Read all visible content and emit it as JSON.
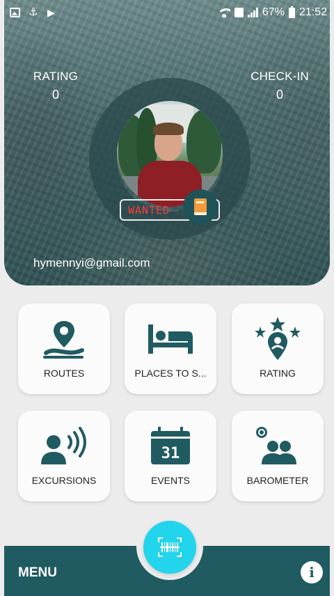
{
  "status_bar": {
    "battery": "67%",
    "time": "21:52",
    "left_icons": [
      "gallery-icon",
      "anchor-icon",
      "flag-icon"
    ],
    "right_icons": [
      "wifi-icon",
      "sim-icon",
      "signal-icon",
      "battery-icon"
    ]
  },
  "profile": {
    "rating_label": "RATING",
    "rating_value": "0",
    "checkin_label": "CHECK-IN",
    "checkin_value": "0",
    "badge_text": "WANTED",
    "email": "hymennyi@gmail.com"
  },
  "tiles": [
    {
      "label": "ROUTES",
      "icon": "route-pin-icon"
    },
    {
      "label": "PLACES TO S...",
      "icon": "bed-icon"
    },
    {
      "label": "RATING",
      "icon": "stars-pin-icon"
    },
    {
      "label": "EXCURSIONS",
      "icon": "audio-guide-icon"
    },
    {
      "label": "EVENTS",
      "icon": "calendar-icon",
      "calendar_day": "31"
    },
    {
      "label": "BAROMETER",
      "icon": "people-gauge-icon"
    }
  ],
  "bottom_bar": {
    "menu_label": "MENU",
    "fab_icon": "barcode-scan-icon",
    "info_icon": "info-icon",
    "info_glyph": "i"
  },
  "colors": {
    "accent": "#1f5b61",
    "fab": "#22d4ec",
    "badge_text": "#ff3b3b",
    "background": "#ececec"
  }
}
